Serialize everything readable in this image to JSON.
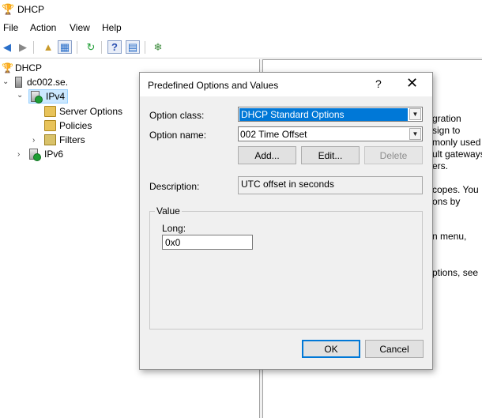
{
  "window": {
    "title": "DHCP"
  },
  "menu": {
    "items": [
      "File",
      "Action",
      "View",
      "Help"
    ]
  },
  "toolbar": {
    "buttons": [
      "back-icon",
      "forward-icon",
      "up-folder-icon",
      "show-hide-tree-icon",
      "refresh-icon",
      "help-icon",
      "properties-icon",
      "connect-icon"
    ]
  },
  "tree": {
    "root": "DHCP",
    "server": "dc002.se.",
    "ipv4": "IPv4",
    "server_options": "Server Options",
    "policies": "Policies",
    "filters": "Filters",
    "ipv6": "IPv6"
  },
  "right_pane": {
    "lines": [
      "gration",
      "sign to",
      "monly used",
      "ult gateways",
      "ers.",
      "copes.  You",
      "ons by",
      "n menu,",
      "ptions, see"
    ]
  },
  "dialog": {
    "title": "Predefined Options and Values",
    "help": "?",
    "close": "✕",
    "option_class_label": "Option class:",
    "option_class_value": "DHCP Standard Options",
    "option_name_label": "Option name:",
    "option_name_value": "002 Time Offset",
    "add_button": "Add...",
    "edit_button": "Edit...",
    "delete_button": "Delete",
    "description_label": "Description:",
    "description_value": "UTC offset in seconds",
    "value_group": "Value",
    "long_label": "Long:",
    "long_value": "0x0",
    "ok_button": "OK",
    "cancel_button": "Cancel"
  }
}
